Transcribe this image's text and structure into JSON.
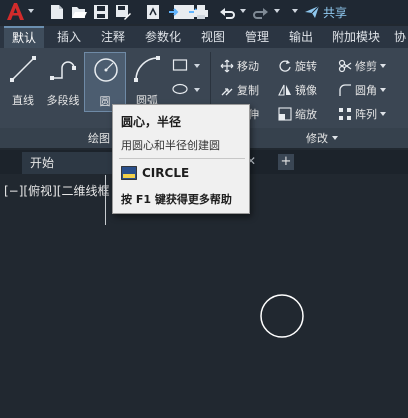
{
  "quick_access": {
    "share_label": "共享",
    "buttons": [
      "new-icon",
      "open-icon",
      "save-icon",
      "save-as-icon",
      "plot-icon",
      "import-icon",
      "export-icon",
      "print-icon",
      "undo-icon",
      "redo-icon"
    ]
  },
  "ribbon_tabs": [
    {
      "label": "默认",
      "active": true
    },
    {
      "label": "插入"
    },
    {
      "label": "注释"
    },
    {
      "label": "参数化"
    },
    {
      "label": "视图"
    },
    {
      "label": "管理"
    },
    {
      "label": "输出"
    },
    {
      "label": "附加模块"
    },
    {
      "label": "协"
    }
  ],
  "draw_panel": {
    "title": "绘图",
    "buttons": [
      {
        "label": "直线",
        "icon": "line-icon"
      },
      {
        "label": "多段线",
        "icon": "polyline-icon"
      },
      {
        "label": "圆",
        "icon": "circle-icon"
      },
      {
        "label": "圆弧",
        "icon": "arc-icon"
      }
    ]
  },
  "modify_panel": {
    "title": "修改",
    "tools": [
      {
        "label": "移动",
        "icon": "move-icon"
      },
      {
        "label": "旋转",
        "icon": "rotate-icon"
      },
      {
        "label": "修剪",
        "icon": "trim-icon"
      },
      {
        "label": "复制",
        "icon": "copy-icon"
      },
      {
        "label": "镜像",
        "icon": "mirror-icon"
      },
      {
        "label": "圆角",
        "icon": "fillet-icon"
      },
      {
        "label": "拉伸",
        "icon": "stretch-icon"
      },
      {
        "label": "缩放",
        "icon": "scale-icon"
      },
      {
        "label": "阵列",
        "icon": "array-icon"
      }
    ]
  },
  "file_tabs": {
    "start_label": "开始",
    "close_label": "✕",
    "add_label": "+"
  },
  "viewport": {
    "controls_label": "[−][俯视][二维线框"
  },
  "tooltip": {
    "title": "圆心，半径",
    "description": "用圆心和半径创建圆",
    "command": "CIRCLE",
    "help_text": "按 F1 键获得更多帮助"
  },
  "colors": {
    "background": "#212830",
    "ribbon": "#3b4653",
    "accent": "#d22b2b",
    "share": "#8fc8ef"
  }
}
